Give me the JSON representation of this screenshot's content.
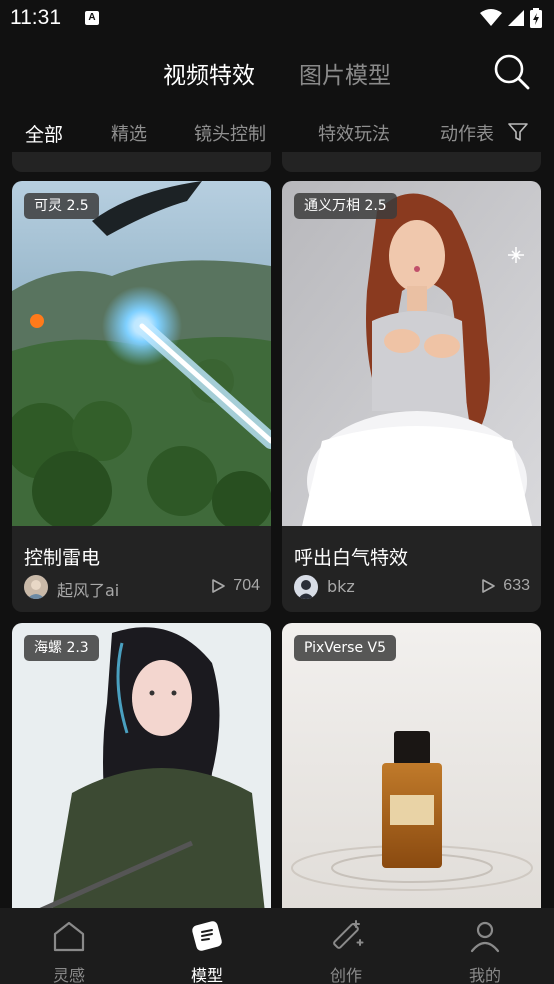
{
  "status": {
    "time": "11:31",
    "notif_glyph": "A"
  },
  "top_tabs": {
    "active": "视频特效",
    "inactive": "图片模型"
  },
  "categories": [
    "全部",
    "精选",
    "镜头控制",
    "特效玩法",
    "动作表"
  ],
  "cards": [
    {
      "badge": "可灵 2.5",
      "title": "控制雷电",
      "author": "起风了ai",
      "plays": "704"
    },
    {
      "badge": "通义万相 2.5",
      "title": "呼出白气特效",
      "author": "bkz",
      "plays": "633"
    },
    {
      "badge": "海螺 2.3"
    },
    {
      "badge": "PixVerse V5"
    }
  ],
  "bottom_nav": [
    {
      "label": "灵感",
      "icon": "home-icon"
    },
    {
      "label": "模型",
      "icon": "model-icon"
    },
    {
      "label": "创作",
      "icon": "magic-wand-icon"
    },
    {
      "label": "我的",
      "icon": "profile-icon"
    }
  ],
  "colors": {
    "background": "#111111",
    "card": "#232323",
    "nav": "#1c1c1c",
    "muted": "#8a8a8a"
  }
}
